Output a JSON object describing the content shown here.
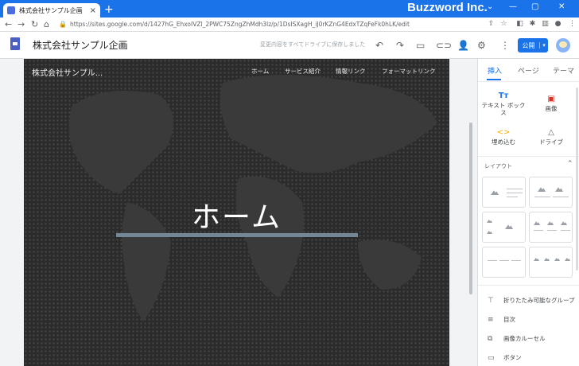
{
  "browser": {
    "tab_title": "株式会社サンプル企画",
    "tab_close": "×",
    "new_tab": "+",
    "brand": "Buzzword Inc.",
    "window_controls": [
      "⌄",
      "—",
      "▢",
      "✕"
    ],
    "nav": [
      "←",
      "→",
      "↻",
      "⌂"
    ],
    "url": "https://sites.google.com/d/1427hG_EhxoIVZl_2PWC75ZngZhMdh3lz/p/1DsISXagH_iJ0rKZnG4EdxTZqFeFk0hLK/edit",
    "lock": "🔒"
  },
  "app": {
    "title": "株式会社サンプル企画",
    "save_status": "変更内容をすべてドライブに保存しました",
    "publish_label": "公開",
    "publish_dropdown": "▾"
  },
  "site": {
    "name": "株式会社サンプル...",
    "nav": [
      "ホーム",
      "サービス紹介",
      "情報リンク",
      "フォーマットリンク"
    ],
    "hero_title": "ホーム"
  },
  "panel": {
    "tabs": [
      "挿入",
      "ページ",
      "テーマ"
    ],
    "insert_items": [
      {
        "icon": "Tт",
        "label": "テキスト ボックス"
      },
      {
        "icon": "▣",
        "label": "画像"
      },
      {
        "icon": "<>",
        "label": "埋め込む"
      },
      {
        "icon": "△",
        "label": "ドライブ"
      }
    ],
    "layout_label": "レイアウト",
    "layout_chevron": "⌃",
    "components": [
      {
        "icon": "⊤",
        "label": "折りたたみ可能なグループ"
      },
      {
        "icon": "≡",
        "label": "目次"
      },
      {
        "icon": "⧉",
        "label": "画像カルーセル"
      },
      {
        "icon": "▭",
        "label": "ボタン"
      }
    ]
  },
  "colors": {
    "accent": "#1a73e8",
    "canvas_bg": "#2b2b2b",
    "hero_bar": "#738796"
  }
}
